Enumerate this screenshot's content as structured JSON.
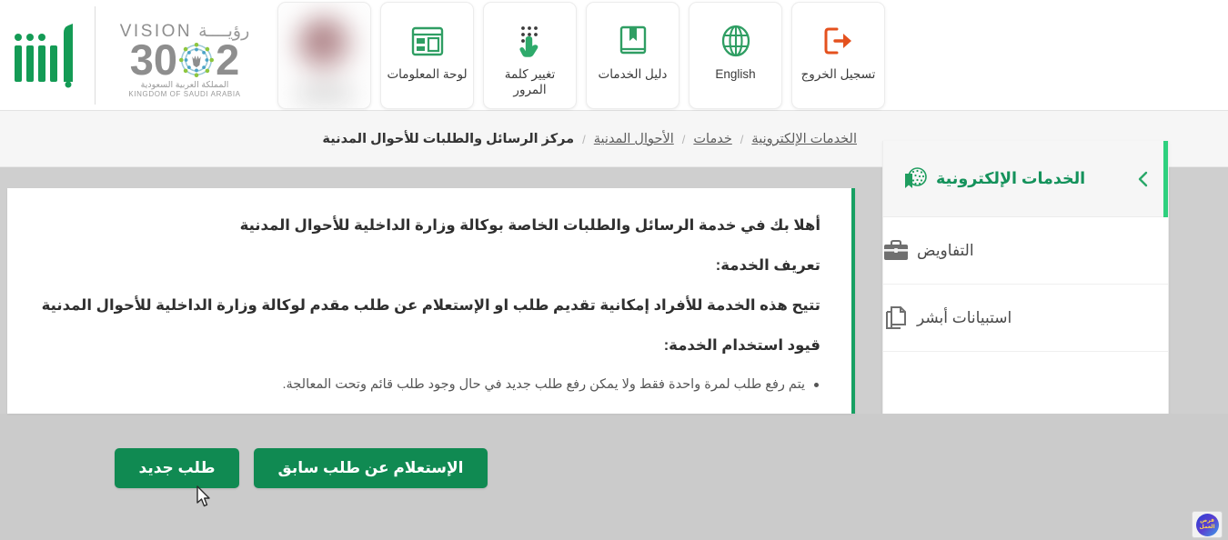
{
  "header": {
    "tools": [
      {
        "label": "لوحة المعلومات",
        "icon": "dashboard-icon"
      },
      {
        "label": "تغيير كلمة المرور",
        "icon": "keypad-hand-icon"
      },
      {
        "label": "دليل الخدمات",
        "icon": "book-icon"
      },
      {
        "label": "English",
        "icon": "globe-icon"
      },
      {
        "label": "تسجيل الخروج",
        "icon": "logout-icon"
      }
    ],
    "avatar_card": {
      "name": "avatar"
    },
    "logo": {
      "absher_alt": "أبشر",
      "vision_word": "VISION",
      "vision_arabic": "رؤيــــة",
      "vision_year_left": "2",
      "vision_year_right": "30",
      "vision_sub_arabic": "المملكة العربية السعودية",
      "vision_sub_english": "KINGDOM OF SAUDI ARABIA"
    }
  },
  "breadcrumb": {
    "items": [
      {
        "label": "الخدمات الإلكترونية",
        "type": "link"
      },
      {
        "label": "خدمات",
        "type": "link"
      },
      {
        "label": "الأحوال المدنية",
        "type": "link"
      },
      {
        "label": "مركز الرسائل والطلبات للأحوال المدنية",
        "type": "current"
      }
    ],
    "separator": "/"
  },
  "sidebar": {
    "header": {
      "title": "الخدمات الإلكترونية",
      "icon": "globe-bookmark-icon",
      "collapse_icon": "chevron-left-icon"
    },
    "items": [
      {
        "label": "التفاويض",
        "icon": "briefcase-icon"
      },
      {
        "label": "استبيانات أبشر",
        "icon": "documents-icon"
      }
    ]
  },
  "main": {
    "welcome": "أهلا بك في خدمة الرسائل والطلبات الخاصة بوكالة وزارة الداخلية للأحوال المدنية",
    "definition_heading": "تعريف الخدمة:",
    "definition_text": "تتيح هذه الخدمة للأفراد إمكانية تقديم طلب او الإستعلام عن طلب مقدم لوكالة وزارة الداخلية للأحوال المدنية",
    "restrictions_heading": "قيود استخدام الخدمة:",
    "restrictions": [
      "يتم رفع طلب لمرة واحدة فقط ولا يمكن رفع طلب جديد في حال وجود طلب قائم وتحت المعالجة."
    ]
  },
  "actions": {
    "previous_request": "الإستعلام عن طلب سابق",
    "new_request": "طلب جديد"
  },
  "floating_badge": {
    "line1": "فرص",
    "line2": "العمل"
  },
  "colors": {
    "brand_green": "#108a52",
    "accent_green": "#2ed07e",
    "sidebar_active_text": "#14925b",
    "logout_orange": "#e4511e",
    "page_gray": "#cbcbcb",
    "card_white": "#ffffff"
  }
}
